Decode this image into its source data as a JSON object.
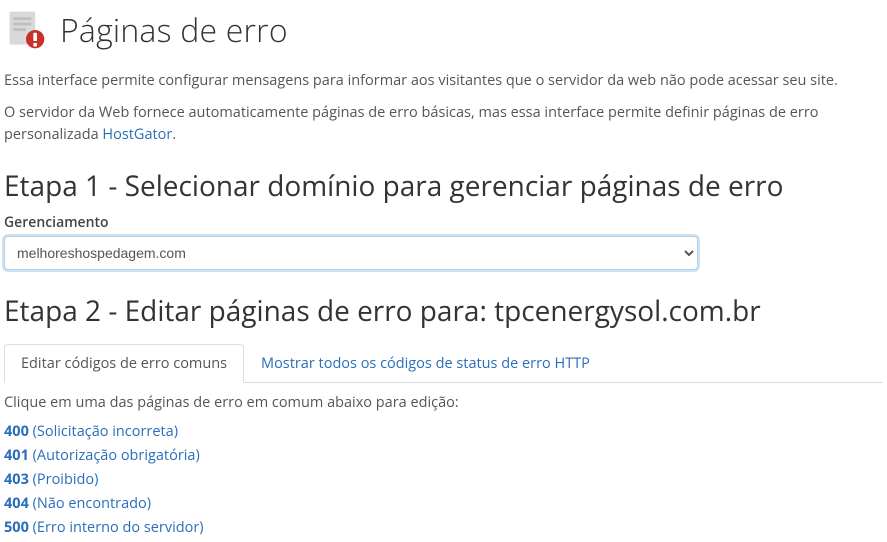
{
  "header": {
    "title": "Páginas de erro"
  },
  "intro": {
    "p1": "Essa interface permite configurar mensagens para informar aos visitantes que o servidor da web não pode acessar seu site.",
    "p2_prefix": "O servidor da Web fornece automaticamente páginas de erro básicas, mas essa interface permite definir páginas de erro personalizada ",
    "p2_link": "HostGator",
    "p2_suffix": "."
  },
  "step1": {
    "heading": "Etapa 1 - Selecionar domínio para gerenciar páginas de erro",
    "label": "Gerenciamento",
    "selected": "melhoreshospedagem.com"
  },
  "step2": {
    "heading": "Etapa 2 - Editar páginas de erro para: tpcenergysol.com.br",
    "tabs": {
      "common": "Editar códigos de erro comuns",
      "all": "Mostrar todos os códigos de status de erro HTTP"
    },
    "help": "Clique em uma das páginas de erro em comum abaixo para edição:",
    "errors": [
      {
        "code": "400",
        "label": "(Solicitação incorreta)"
      },
      {
        "code": "401",
        "label": "(Autorização obrigatória)"
      },
      {
        "code": "403",
        "label": "(Proibido)"
      },
      {
        "code": "404",
        "label": "(Não encontrado)"
      },
      {
        "code": "500",
        "label": "(Erro interno do servidor)"
      }
    ]
  }
}
